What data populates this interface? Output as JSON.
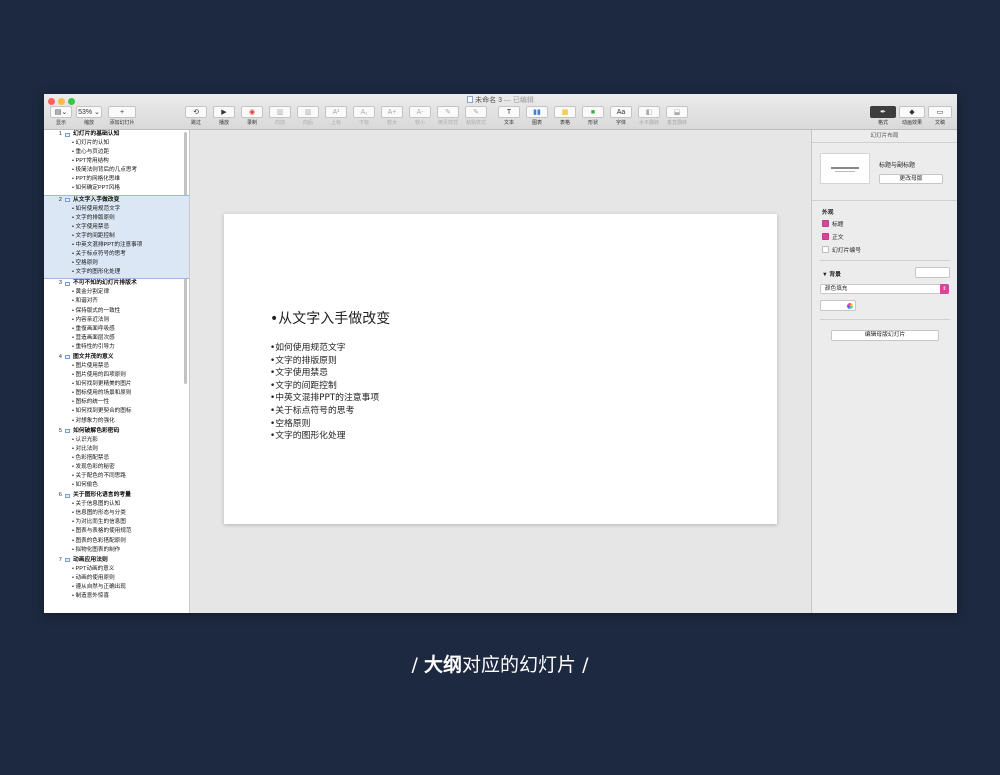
{
  "window": {
    "title": "未命名 3",
    "status": "— 已编辑"
  },
  "toolbar": {
    "left": [
      {
        "label": "显示",
        "glyph": "▤⌄"
      },
      {
        "label": "缩放",
        "glyph": "53% ⌄"
      },
      {
        "label": "添加幻灯片",
        "glyph": "+"
      }
    ],
    "center": [
      {
        "label": "跳过",
        "glyph": "⟲",
        "enabled": true
      },
      {
        "label": "播放",
        "glyph": "▶",
        "enabled": true
      },
      {
        "label": "录制",
        "glyph": "◉",
        "enabled": true
      },
      {
        "label": "向前",
        "glyph": "▥",
        "enabled": false
      },
      {
        "label": "向后",
        "glyph": "▥",
        "enabled": false
      },
      {
        "label": "上标",
        "glyph": "A¹",
        "enabled": false
      },
      {
        "label": "下标",
        "glyph": "A₁",
        "enabled": false
      },
      {
        "label": "较大",
        "glyph": "A+",
        "enabled": false
      },
      {
        "label": "较小",
        "glyph": "A-",
        "enabled": false
      },
      {
        "label": "拷贝样式",
        "glyph": "✎",
        "enabled": false
      },
      {
        "label": "粘贴样式",
        "glyph": "✎",
        "enabled": false
      },
      {
        "label": "文本",
        "glyph": "T",
        "enabled": true
      },
      {
        "label": "图表",
        "glyph": "▮▮",
        "enabled": true
      },
      {
        "label": "表格",
        "glyph": "▦",
        "enabled": true
      },
      {
        "label": "形状",
        "glyph": "■",
        "enabled": true
      },
      {
        "label": "字体",
        "glyph": "Aa",
        "enabled": true
      },
      {
        "label": "水平翻转",
        "glyph": "◧",
        "enabled": false
      },
      {
        "label": "垂直翻转",
        "glyph": "⬓",
        "enabled": false
      }
    ],
    "right": [
      {
        "label": "格式",
        "glyph": "✒",
        "active": true
      },
      {
        "label": "动画效果",
        "glyph": "◆",
        "active": false
      },
      {
        "label": "文稿",
        "glyph": "▭",
        "active": false
      }
    ]
  },
  "outline": [
    {
      "number": "1",
      "title": "幻灯片的基础认知",
      "selected": false,
      "bullets": [
        "幻灯片的认知",
        "重心与页边距",
        "PPT常用结构",
        "极简法则背后的几点思考",
        "PPT的网格化思维",
        "如何确定PPT风格"
      ]
    },
    {
      "number": "2",
      "title": "从文字入手做改变",
      "selected": true,
      "bullets": [
        "如何使用规范文字",
        "文字的排版原则",
        "文字使用禁忌",
        "文字的间距控制",
        "中英文混排PPT的注意事项",
        "关于标点符号的思考",
        "空格原则",
        "文字的图形化处理"
      ]
    },
    {
      "number": "3",
      "title": "不可不知的幻灯片排版术",
      "selected": false,
      "bullets": [
        "黄金分割定律",
        "和谐对齐",
        "保持版式的一致性",
        "内容亲近法则",
        "重復画面呼吸感",
        "营造画面层次感",
        "重特性的引导力"
      ]
    },
    {
      "number": "4",
      "title": "图文并茂的意义",
      "selected": false,
      "bullets": [
        "图片使用禁忌",
        "图片使用的四项原则",
        "如何找到更精美的图片",
        "图标使用的场景和原则",
        "图标的统一性",
        "如何找到更契合的图标",
        "对想象力的强化"
      ]
    },
    {
      "number": "5",
      "title": "如何破解色彩密码",
      "selected": false,
      "bullets": [
        "认识光影",
        "对比法则",
        "色彩搭配禁忌",
        "发现色彩的秘密",
        "关于配色的不同思路",
        "如何偷色"
      ]
    },
    {
      "number": "6",
      "title": "关于图形化语言的考量",
      "selected": false,
      "bullets": [
        "关于信息图的认知",
        "信息图的形态与分类",
        "为对比而生的信息图",
        "图表与表格的使用规范",
        "图表的色彩搭配原则",
        "拟物化图表的制作"
      ]
    },
    {
      "number": "7",
      "title": "动画应用法则",
      "selected": false,
      "bullets": [
        "PPT动画的意义",
        "动画的使用原则",
        "遵从自然与正确出现",
        "制造意外惊喜"
      ]
    }
  ],
  "slide": {
    "title": "•从文字入手做改变",
    "bullets": [
      "•如何使用规范文字",
      "•文字的排版原则",
      "•文字使用禁忌",
      "•文字的间距控制",
      "•中英文混排PPT的注意事项",
      "•关于标点符号的思考",
      "•空格原则",
      "•文字的图形化处理"
    ]
  },
  "inspector": {
    "header": "幻灯片布局",
    "layout_name": "标题与副标题",
    "change_master": "更改母版",
    "appearance_title": "外观",
    "checkboxes": [
      {
        "label": "标题",
        "checked": true
      },
      {
        "label": "正文",
        "checked": true
      },
      {
        "label": "幻灯片编号",
        "checked": false
      }
    ],
    "background_title": "▼ 背景",
    "fill_option": "颜色填充",
    "edit_master": "编辑母版幻灯片",
    "accent_color": "#d6479a"
  },
  "caption": {
    "left_slash": "/",
    "bold": "大纲",
    "rest": "对应的幻灯片",
    "right_slash": "/"
  }
}
